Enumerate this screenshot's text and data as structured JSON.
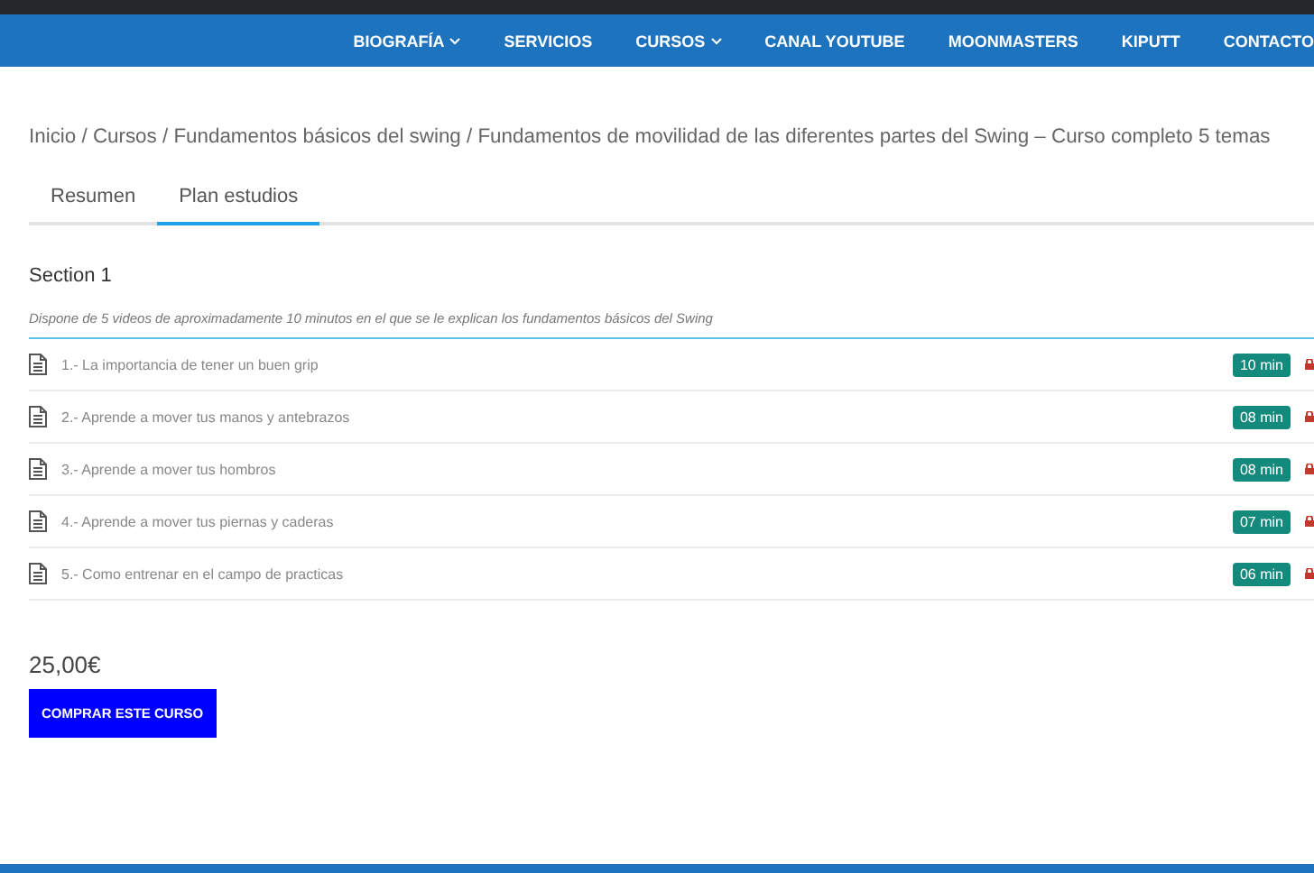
{
  "nav": {
    "items": [
      {
        "label": "BIOGRAFÍA",
        "dropdown": true
      },
      {
        "label": "SERVICIOS",
        "dropdown": false
      },
      {
        "label": "CURSOS",
        "dropdown": true
      },
      {
        "label": "CANAL YOUTUBE",
        "dropdown": false
      },
      {
        "label": "MOONMASTERS",
        "dropdown": false
      },
      {
        "label": "KIPUTT",
        "dropdown": false
      },
      {
        "label": "CONTACTO",
        "dropdown": false
      }
    ]
  },
  "breadcrumb": "Inicio / Cursos / Fundamentos básicos del swing / Fundamentos de movilidad de las diferentes partes del Swing – Curso completo 5 temas",
  "tabs": [
    {
      "label": "Resumen",
      "selected": false
    },
    {
      "label": "Plan estudios",
      "selected": true
    }
  ],
  "section": {
    "title": "Section 1",
    "description": "Dispone de 5 videos de aproximadamente 10 minutos en el que se le explican los fundamentos básicos del Swing",
    "lessons": [
      {
        "title": "1.- La importancia de tener un buen grip",
        "duration": "10 min",
        "locked": true
      },
      {
        "title": "2.- Aprende a mover tus manos y antebrazos",
        "duration": "08 min",
        "locked": true
      },
      {
        "title": "3.- Aprende a mover tus hombros",
        "duration": "08 min",
        "locked": true
      },
      {
        "title": "4.- Aprende a mover tus piernas y caderas",
        "duration": "07 min",
        "locked": true
      },
      {
        "title": "5.- Como entrenar en el campo de practicas",
        "duration": "06 min",
        "locked": true
      }
    ]
  },
  "price": "25,00€",
  "buy_button": "COMPRAR ESTE CURSO"
}
